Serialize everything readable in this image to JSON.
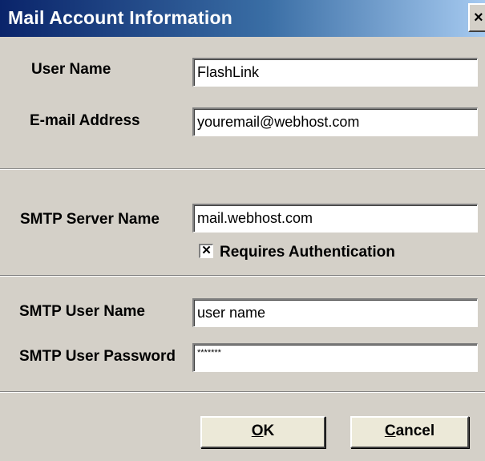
{
  "window": {
    "title": "Mail Account Information",
    "close_glyph": "×"
  },
  "account": {
    "user_name_label": "User Name",
    "user_name_value": "FlashLink",
    "email_label": "E-mail Address",
    "email_value": "youremail@webhost.com"
  },
  "smtp": {
    "server_label": "SMTP Server Name",
    "server_value": "mail.webhost.com",
    "auth_checked_glyph": "✕",
    "auth_label": "Requires Authentication",
    "auth_checked": true
  },
  "credentials": {
    "user_label": "SMTP User Name",
    "user_value": "user name",
    "password_label": "SMTP User Password",
    "password_value": "*******"
  },
  "buttons": {
    "ok_mnemonic": "O",
    "ok_rest": "K",
    "cancel_mnemonic": "C",
    "cancel_rest": "ancel"
  },
  "colors": {
    "dialog_bg": "#d4d0c8",
    "title_start": "#0a246a",
    "title_end": "#a6caf0",
    "button_bg": "#ece9d8"
  }
}
